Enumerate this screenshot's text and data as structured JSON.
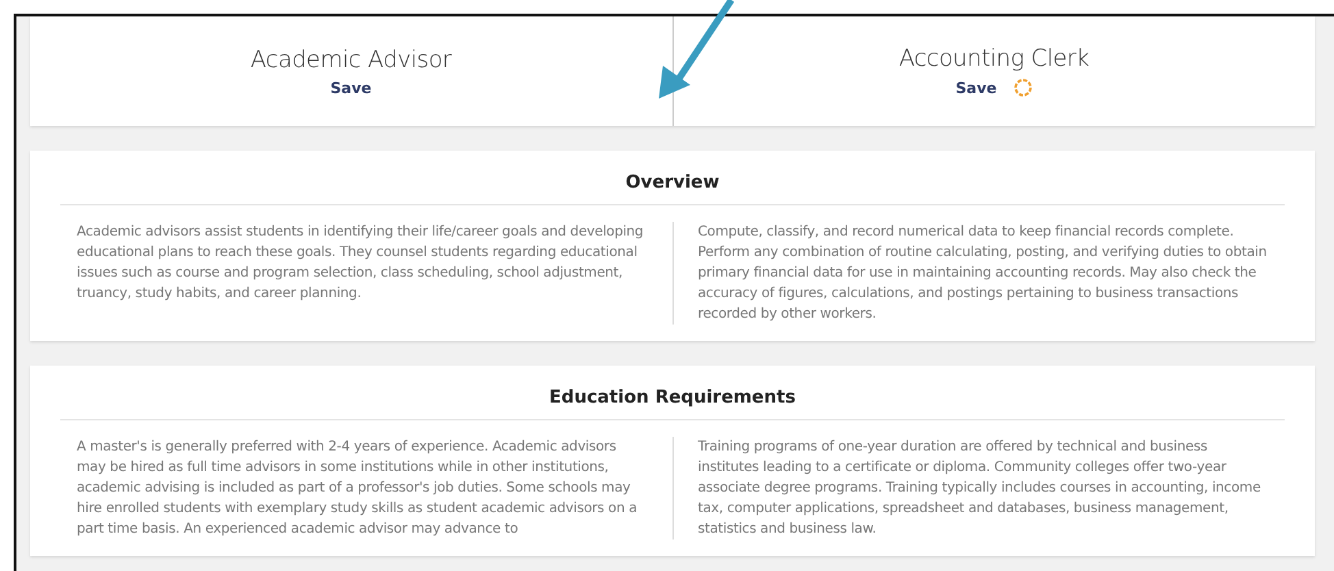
{
  "careers": [
    {
      "title": "Academic Advisor",
      "save": "Save",
      "loading": false
    },
    {
      "title": "Accounting Clerk",
      "save": "Save",
      "loading": true
    }
  ],
  "sections": [
    {
      "heading": "Overview",
      "texts": [
        "Academic advisors assist students in identifying their life/career goals and developing educational plans to reach these goals. They counsel students regarding educational issues such as course and program selection, class scheduling, school adjustment, truancy, study habits, and career planning.",
        "Compute, classify, and record numerical data to keep financial records complete. Perform any combination of routine calculating, posting, and verifying duties to obtain primary financial data for use in maintaining accounting records. May also check the accuracy of figures, calculations, and postings pertaining to business transactions recorded by other workers."
      ]
    },
    {
      "heading": "Education Requirements",
      "texts": [
        "A master's is generally preferred with 2-4 years of experience. Academic advisors may be hired as full time advisors in some institutions while in other institutions, academic advising is included as part of a professor's job duties. Some schools may hire enrolled students with exemplary study skills as student academic advisors on a part time basis. An experienced academic advisor may advance to",
        "Training programs of one-year duration are offered by technical and business institutes leading to a certificate or diploma. Community colleges offer two-year associate degree programs. Training typically includes courses in accounting, income tax, computer applications, spreadsheet and databases, business management, statistics and business law."
      ]
    }
  ]
}
